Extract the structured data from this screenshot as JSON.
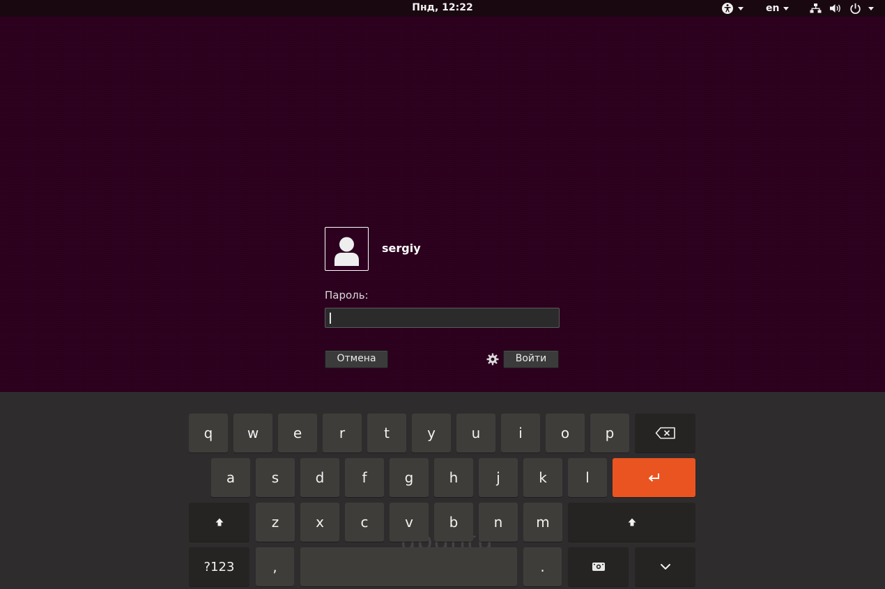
{
  "top_bar": {
    "clock": "Пнд, 12:22",
    "language": "en",
    "icons": [
      "accessibility-icon",
      "network-icon",
      "volume-icon",
      "power-icon"
    ]
  },
  "login": {
    "username": "sergiy",
    "password_label": "Пароль:",
    "password_value": "",
    "cancel_label": "Отмена",
    "login_label": "Войти"
  },
  "keyboard": {
    "watermark": "ubuntu",
    "row1": [
      "q",
      "w",
      "e",
      "r",
      "t",
      "y",
      "u",
      "i",
      "o",
      "p"
    ],
    "row2": [
      "a",
      "s",
      "d",
      "f",
      "g",
      "h",
      "j",
      "k",
      "l"
    ],
    "row3": [
      "z",
      "x",
      "c",
      "v",
      "b",
      "n",
      "m"
    ],
    "numbers_label": "?123",
    "comma_label": ",",
    "period_label": "."
  },
  "colors": {
    "background": "#2c001e",
    "keyboard_background": "#2f2c2e",
    "key": "#3f3d3a",
    "modifier_key": "#252422",
    "enter_key": "#e95420"
  }
}
